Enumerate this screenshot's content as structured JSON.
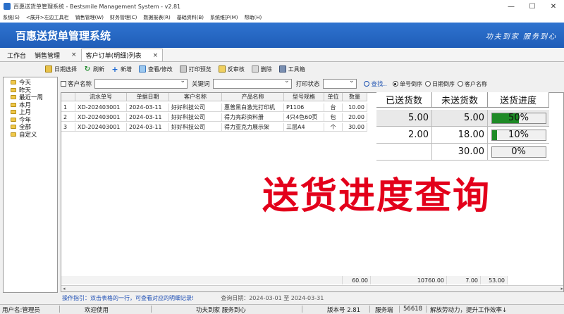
{
  "window": {
    "title": "百惠送货单管理系统 - Bestsmile Management System - v2.81",
    "minimize": "—",
    "maximize": "☐",
    "close": "✕"
  },
  "menu": [
    "系统(S)",
    "<展开>左边工具栏",
    "销售管理(W)",
    "财务管理(C)",
    "数据报表(R)",
    "基础资料(B)",
    "系统维护(M)",
    "帮助(H)"
  ],
  "banner": {
    "app_title": "百惠送货单管理系统",
    "slogan": "功夫到家  服务到心"
  },
  "tabs": [
    {
      "label": "工作台",
      "closable": false,
      "active": false
    },
    {
      "label": "销售管理",
      "closable": true,
      "active": false
    },
    {
      "label": "客户订单(明细)列表",
      "closable": true,
      "active": true
    }
  ],
  "tab_close_glyph": "×",
  "toolbar": {
    "date_select": "日期选择",
    "refresh": "刷新",
    "add": "新增",
    "view_edit": "查看/修改",
    "print_preview": "打印预览",
    "unaudit": "反审核",
    "delete": "删除",
    "toolbox": "工具箱"
  },
  "tree": [
    "今天",
    "昨天",
    "最近一周",
    "本月",
    "上月",
    "今年",
    "全部",
    "自定义"
  ],
  "filter": {
    "customer_label": "客户名称",
    "keyword_label": "关键词",
    "print_status_label": "打印状态",
    "query_label": "查找..",
    "sort_options": [
      {
        "label": "单号倒序",
        "checked": true
      },
      {
        "label": "日期倒序",
        "checked": false
      },
      {
        "label": "客户名称",
        "checked": false
      }
    ]
  },
  "grid": {
    "headers": [
      "",
      "流水单号",
      "单据日期",
      "客户名称",
      "产品名称",
      "型号规格",
      "单位",
      "数量"
    ],
    "rows": [
      [
        "1",
        "XD-202403001",
        "2024-03-11",
        "好好科技公司",
        "惠普黑白激光打印机",
        "P1106",
        "台",
        "10.00"
      ],
      [
        "2",
        "XD-202403001",
        "2024-03-11",
        "好好科技公司",
        "得力亮彩资料册",
        "4只4色60页",
        "包",
        "20.00"
      ],
      [
        "3",
        "XD-202403001",
        "2024-03-11",
        "好好科技公司",
        "得力亚克力展示架",
        "三层A4",
        "个",
        "30.00"
      ]
    ],
    "footer": {
      "qty_total": "60.00",
      "amount_total": "10760.00",
      "delivered_total": "7.00",
      "undelivered_total": "53.00"
    }
  },
  "delivery_overlay": {
    "headers": [
      "已送货数",
      "未送货数",
      "送货进度"
    ],
    "rows": [
      {
        "delivered": "5.00",
        "undelivered": "5.00",
        "progress_text": "50%",
        "progress": 0.5
      },
      {
        "delivered": "2.00",
        "undelivered": "18.00",
        "progress_text": "10%",
        "progress": 0.1
      },
      {
        "delivered": "",
        "undelivered": "30.00",
        "progress_text": "0%",
        "progress": 0
      }
    ]
  },
  "big_title": "送货进度查询",
  "hint": {
    "text": "操作指引：双击表格的一行，可查看对应的明细记录!",
    "query_date": "查询日期：2024-03-01 至 2024-03-31"
  },
  "status": {
    "user": "用户名:管理员",
    "welcome": "欢迎使用",
    "motto": "功夫到家 服务到心",
    "version": "版本号 2.81",
    "server_label": "服务端",
    "server_value": "56618",
    "slogan": "解放劳动力，提升工作效率↓"
  },
  "colors": {
    "banner": "#2f73cf",
    "progress_fill": "#1e8a26",
    "big_title": "#e3001b",
    "hint_text": "#1e4fb5"
  }
}
